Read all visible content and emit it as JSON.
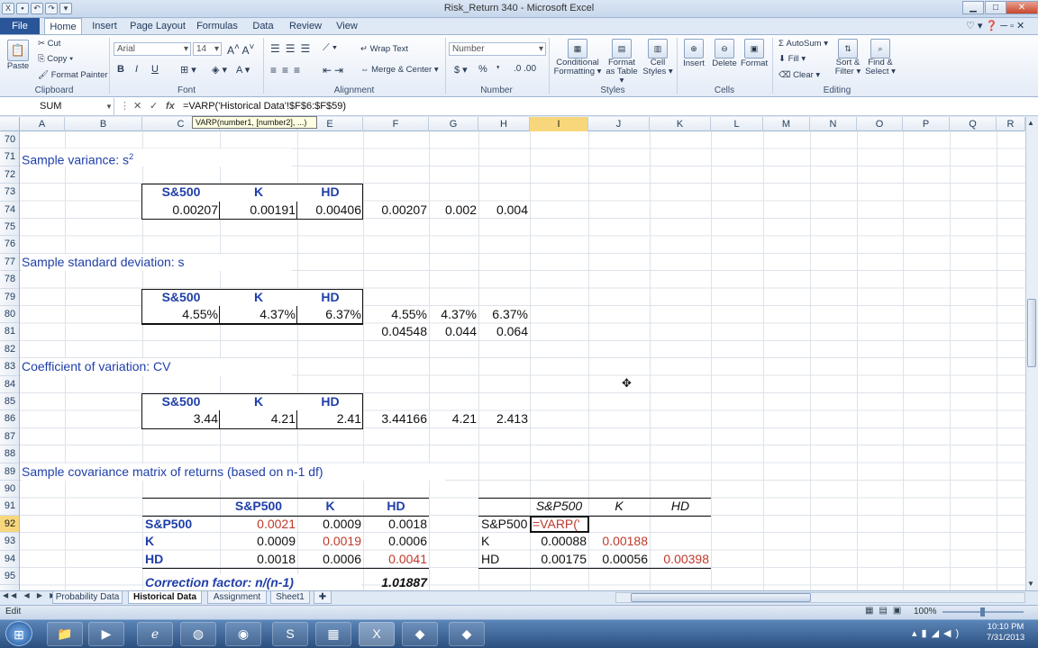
{
  "window": {
    "title": "Risk_Return 340  -  Microsoft Excel",
    "qat_icons": [
      "save-icon",
      "undo-icon",
      "redo-icon",
      "customize-icon"
    ],
    "controls": [
      "minimize",
      "maximize",
      "close"
    ]
  },
  "ribbon_tabs": [
    {
      "label": "File",
      "active": false
    },
    {
      "label": "Home",
      "active": true
    },
    {
      "label": "Insert",
      "active": false
    },
    {
      "label": "Page Layout",
      "active": false
    },
    {
      "label": "Formulas",
      "active": false
    },
    {
      "label": "Data",
      "active": false
    },
    {
      "label": "Review",
      "active": false
    },
    {
      "label": "View",
      "active": false
    }
  ],
  "ribbon": {
    "clipboard": {
      "paste": "Paste",
      "cut": "Cut",
      "copy": "Copy ▾",
      "format_painter": "Format Painter",
      "label": "Clipboard"
    },
    "font": {
      "name": "Arial",
      "size": "14",
      "label": "Font",
      "bold": "B",
      "italic": "I",
      "underline": "U"
    },
    "alignment": {
      "wrap": "Wrap Text",
      "merge": "Merge & Center ▾",
      "label": "Alignment"
    },
    "number": {
      "format": "Number",
      "currency": "$ ▾",
      "percent": "%",
      "comma": "❜",
      "label": "Number"
    },
    "styles": {
      "conditional": "Conditional Formatting ▾",
      "format_table": "Format as Table ▾",
      "cell_styles": "Cell Styles ▾",
      "label": "Styles"
    },
    "cells": {
      "insert": "Insert",
      "delete": "Delete",
      "format": "Format",
      "label": "Cells"
    },
    "editing": {
      "autosum": "AutoSum ▾",
      "fill": "Fill ▾",
      "clear": "Clear ▾",
      "sort": "Sort & Filter ▾",
      "find": "Find & Select ▾",
      "label": "Editing"
    }
  },
  "formula_bar": {
    "name_box": "SUM",
    "formula": "=VARP('Historical Data'!$F$6:$F$59)",
    "tooltip": "VARP(number1, [number2], ...)"
  },
  "columns": [
    "A",
    "B",
    "C",
    "D",
    "E",
    "F",
    "G",
    "H",
    "I",
    "J",
    "K",
    "L",
    "M",
    "N",
    "O",
    "P",
    "Q",
    "R"
  ],
  "rows": [
    "70",
    "71",
    "72",
    "73",
    "74",
    "75",
    "76",
    "77",
    "78",
    "79",
    "80",
    "81",
    "82",
    "83",
    "84",
    "85",
    "86",
    "87",
    "88",
    "89",
    "90",
    "91",
    "92",
    "93",
    "94",
    "95"
  ],
  "selected": {
    "column": "I",
    "row": "92"
  },
  "sheet": {
    "sample_variance_label": "Sample variance: s",
    "sample_variance_sup": "2",
    "sample_std_label": "Sample standard deviation: s",
    "cv_label": "Coefficient of variation: CV",
    "cov_label": "Sample covariance matrix of returns (based on n-1 df)",
    "box_headers": [
      "S&500",
      "K",
      "HD"
    ],
    "variance_values": [
      "0.00207",
      "0.00191",
      "0.00406",
      "0.00207",
      "0.002",
      "0.004"
    ],
    "std_values": [
      "4.55%",
      "4.37%",
      "6.37%",
      "4.55%",
      "4.37%",
      "6.37%"
    ],
    "std_row81": [
      "0.04548",
      "0.044",
      "0.064"
    ],
    "cv_values": [
      "3.44",
      "4.21",
      "2.41",
      "3.44166",
      "4.21",
      "2.413"
    ],
    "cov_headers": [
      "S&P500",
      "K",
      "HD"
    ],
    "cov_rows": [
      {
        "label": "S&P500",
        "values": [
          "0.0021",
          "0.0009",
          "0.0018"
        ]
      },
      {
        "label": "K",
        "values": [
          "0.0009",
          "0.0019",
          "0.0006"
        ]
      },
      {
        "label": "HD",
        "values": [
          "0.0018",
          "0.0006",
          "0.0041"
        ]
      }
    ],
    "correction_label": "Correction factor: n/(n-1)",
    "correction_value": "1.01887",
    "cov2_headers": [
      "S&P500",
      "K",
      "HD"
    ],
    "cov2_rows": [
      {
        "label": "S&P500",
        "values": [
          "=VARP('",
          "",
          ""
        ]
      },
      {
        "label": "K",
        "values": [
          "0.00088",
          "0.00188",
          ""
        ]
      },
      {
        "label": "HD",
        "values": [
          "0.00175",
          "0.00056",
          "0.00398"
        ]
      }
    ]
  },
  "sheet_tabs": [
    {
      "label": "Probability Data",
      "active": false
    },
    {
      "label": "Historical Data",
      "active": true
    },
    {
      "label": "Assignment",
      "active": false
    },
    {
      "label": "Sheet1",
      "active": false
    }
  ],
  "status": {
    "mode": "Edit",
    "zoom": "100%"
  },
  "taskbar": {
    "time": "10:10 PM",
    "date": "7/31/2013"
  },
  "colors": {
    "accent_blue": "#1f3fa8",
    "red_values": "#c0392b",
    "selection": "#f8d77c",
    "file_tab": "#2a5699"
  }
}
